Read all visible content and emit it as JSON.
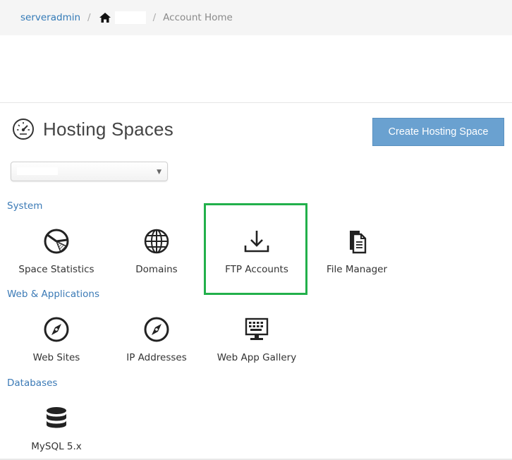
{
  "breadcrumb": {
    "user": "serveradmin",
    "separator": "/",
    "current": "Account Home"
  },
  "header": {
    "title": "Hosting Spaces",
    "create_button": "Create Hosting Space"
  },
  "space_select": {
    "caret": "▼"
  },
  "sections": {
    "system": {
      "label": "System",
      "items": [
        {
          "label": "Space Statistics",
          "icon": "pie-chart-icon"
        },
        {
          "label": "Domains",
          "icon": "globe-icon"
        },
        {
          "label": "FTP Accounts",
          "icon": "download-icon"
        },
        {
          "label": "File Manager",
          "icon": "file-icon"
        }
      ]
    },
    "web": {
      "label": "Web & Applications",
      "items": [
        {
          "label": "Web Sites",
          "icon": "compass-icon"
        },
        {
          "label": "IP Addresses",
          "icon": "compass-icon"
        },
        {
          "label": "Web App Gallery",
          "icon": "keyboard-monitor-icon"
        }
      ]
    },
    "databases": {
      "label": "Databases",
      "items": [
        {
          "label": "MySQL 5.x",
          "icon": "database-icon"
        }
      ]
    }
  },
  "colors": {
    "link": "#337ab7",
    "button": "#6aa1d0",
    "highlight": "#22b04b"
  }
}
